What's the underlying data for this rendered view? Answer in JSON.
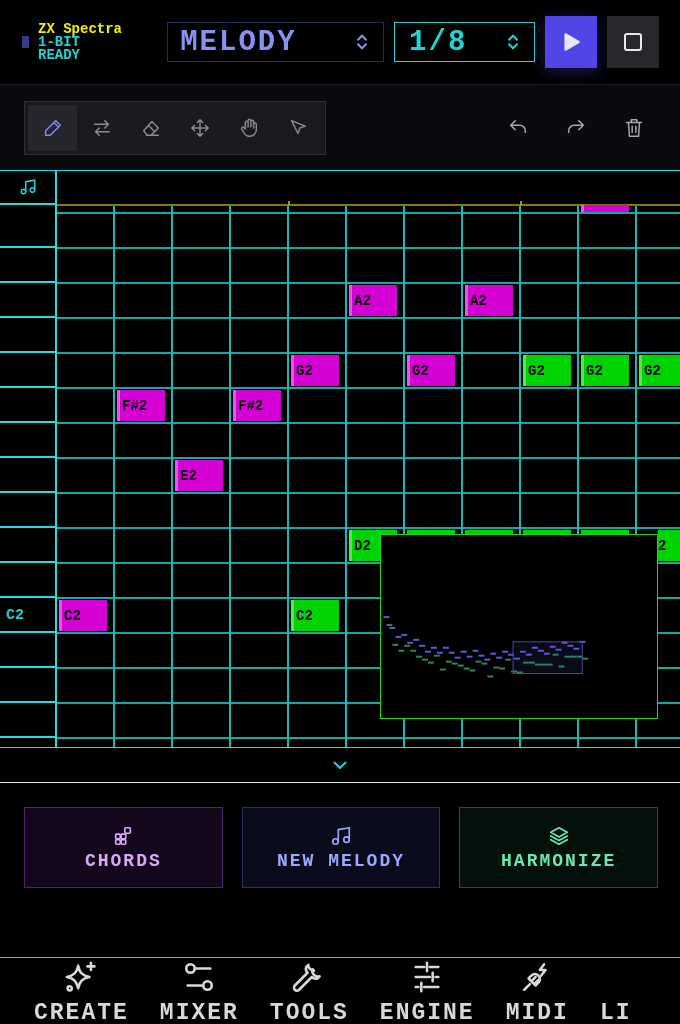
{
  "status": {
    "name": "ZX Spectra",
    "mode": "1-BIT",
    "state": "READY"
  },
  "track_select": {
    "value": "MELODY"
  },
  "grid_select": {
    "value": "1/8"
  },
  "tools": [
    {
      "kind": "pencil",
      "selected": true
    },
    {
      "kind": "swap",
      "selected": false
    },
    {
      "kind": "eraser",
      "selected": false
    },
    {
      "kind": "move",
      "selected": false
    },
    {
      "kind": "hand",
      "selected": false
    },
    {
      "kind": "pointer",
      "selected": false
    }
  ],
  "piano_roll": {
    "top_lane": {
      "cells": [
        null,
        null,
        null,
        null,
        null,
        null,
        null,
        null,
        null,
        {
          "kind": "edge",
          "color": "#d400d4"
        },
        null
      ]
    },
    "lanes": [
      {
        "kind": "empty"
      },
      {
        "kind": "empty"
      },
      {
        "kind": "notes",
        "cells": [
          null,
          null,
          null,
          null,
          null,
          {
            "kind": "full",
            "label": "A2",
            "color": "#d400d4"
          },
          null,
          {
            "kind": "full",
            "label": "A2",
            "color": "#d400d4"
          },
          null,
          null,
          null
        ]
      },
      {
        "kind": "empty"
      },
      {
        "kind": "notes",
        "cells": [
          null,
          null,
          null,
          null,
          {
            "kind": "full",
            "label": "G2",
            "color": "#d400d4"
          },
          null,
          {
            "kind": "full",
            "label": "G2",
            "color": "#d400d4"
          },
          null,
          {
            "kind": "full",
            "label": "G2",
            "color": "#00d400"
          },
          {
            "kind": "full",
            "label": "G2",
            "color": "#00d400"
          },
          {
            "kind": "full",
            "label": "G2",
            "color": "#00d400"
          }
        ]
      },
      {
        "kind": "notes",
        "cells": [
          null,
          {
            "kind": "full",
            "label": "F#2",
            "color": "#d400d4"
          },
          null,
          {
            "kind": "full",
            "label": "F#2",
            "color": "#d400d4"
          },
          null,
          null,
          null,
          null,
          null,
          null,
          null
        ]
      },
      {
        "kind": "empty"
      },
      {
        "kind": "notes",
        "cells": [
          null,
          null,
          {
            "kind": "full",
            "label": "E2",
            "color": "#d400d4"
          },
          null,
          null,
          null,
          null,
          null,
          null,
          null,
          null
        ]
      },
      {
        "kind": "empty"
      },
      {
        "kind": "notes",
        "cells": [
          null,
          null,
          null,
          null,
          null,
          {
            "kind": "full",
            "label": "D2",
            "color": "#00d400"
          },
          {
            "kind": "edge",
            "color": "#00d400"
          },
          {
            "kind": "edge",
            "color": "#00d400"
          },
          {
            "kind": "edge",
            "color": "#00d400"
          },
          {
            "kind": "edge",
            "color": "#00d400"
          },
          {
            "kind": "tail",
            "label": "2",
            "color": "#00d400"
          }
        ]
      },
      {
        "kind": "empty"
      },
      {
        "kind": "notes",
        "label": "C2",
        "cells": [
          {
            "kind": "full",
            "label": "C2",
            "color": "#d400d4"
          },
          null,
          null,
          null,
          {
            "kind": "full",
            "label": "C2",
            "color": "#00d400"
          },
          null,
          null,
          null,
          null,
          null,
          null
        ]
      },
      {
        "kind": "empty"
      },
      {
        "kind": "empty"
      },
      {
        "kind": "empty"
      }
    ]
  },
  "actions": [
    {
      "kind": "chords",
      "label": "CHORDS"
    },
    {
      "kind": "melody",
      "label": "NEW MELODY"
    },
    {
      "kind": "harmonize",
      "label": "HARMONIZE"
    }
  ],
  "nav": [
    {
      "kind": "create",
      "label": "CREATE"
    },
    {
      "kind": "mixer",
      "label": "MIXER"
    },
    {
      "kind": "tools",
      "label": "TOOLS"
    },
    {
      "kind": "engine",
      "label": "ENGINE"
    },
    {
      "kind": "midi",
      "label": "MIDI"
    },
    {
      "kind": "cut",
      "label": "LI"
    }
  ]
}
